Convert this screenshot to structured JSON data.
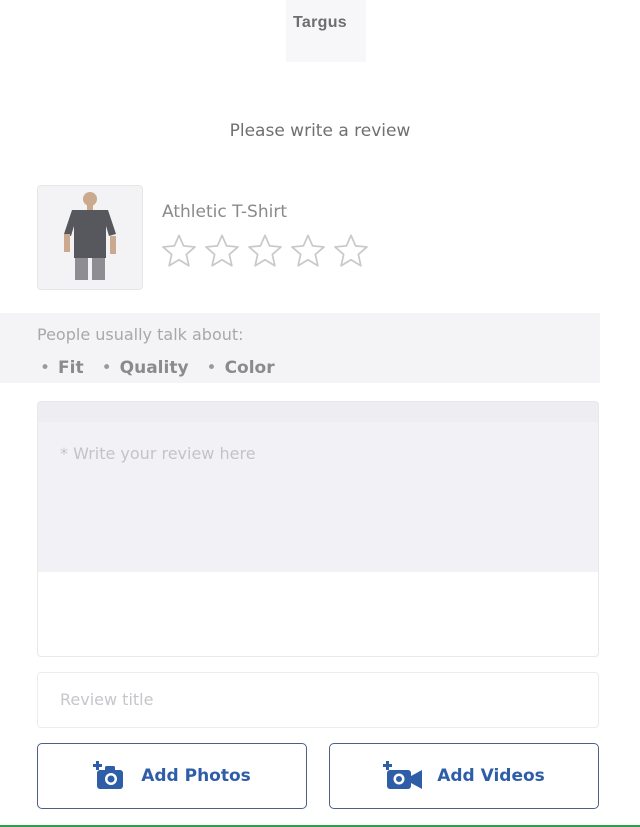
{
  "header": {
    "brand": "Targus"
  },
  "form": {
    "heading": "Please write a review",
    "product": {
      "name": "Athletic T-Shirt",
      "rating": 0,
      "rating_max": 5
    },
    "topics": {
      "label": "People usually talk about:",
      "items": [
        "Fit",
        "Quality",
        "Color"
      ]
    },
    "review_field": {
      "placeholder": "* Write your review here",
      "value": ""
    },
    "title_field": {
      "placeholder": "Review title",
      "value": ""
    },
    "buttons": {
      "add_photos": "Add Photos",
      "add_videos": "Add Videos"
    }
  },
  "colors": {
    "accent": "#2f5ea8",
    "button_border": "#4e5f86",
    "star_outline": "#c9c9cc"
  },
  "icons": {
    "add_photo": "camera-plus-icon",
    "add_video": "video-camera-plus-icon",
    "star": "star-outline-icon"
  }
}
